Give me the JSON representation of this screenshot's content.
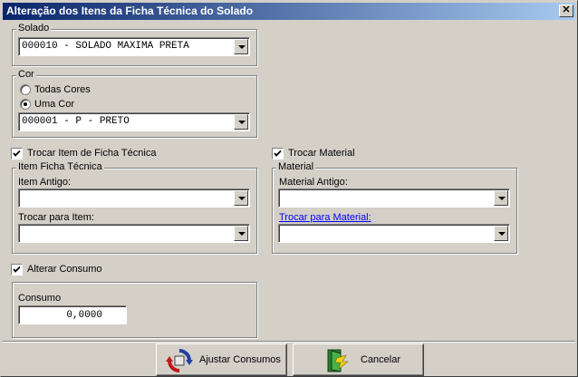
{
  "window": {
    "title": "Alteração dos Itens da Ficha Técnica do Solado",
    "close_label": "✕"
  },
  "solado": {
    "legend": "Solado",
    "value": "000010 - SOLADO MAXIMA PRETA"
  },
  "cor": {
    "legend": "Cor",
    "option_all": "Todas Cores",
    "option_one": "Uma Cor",
    "selected": "Uma Cor",
    "value": "000001 - P - PRETO"
  },
  "trocar_item": {
    "checkbox_label": "Trocar Item de Ficha Técnica",
    "checked": true,
    "legend": "Item Ficha Técnica",
    "old_label": "Item Antigo:",
    "old_value": "",
    "new_label": "Trocar para Item:",
    "new_value": ""
  },
  "trocar_material": {
    "checkbox_label": "Trocar Material",
    "checked": true,
    "legend": "Material",
    "old_label": "Material Antigo:",
    "old_value": "",
    "new_label": "Trocar para Material:",
    "new_value": ""
  },
  "consumo": {
    "checkbox_label": "Alterar Consumo",
    "checked": true,
    "label": "Consumo",
    "value": "0,0000"
  },
  "buttons": {
    "ajustar": "Ajustar Consumos",
    "cancelar": "Cancelar",
    "ajustar_icon": "refresh-arrows-icon",
    "cancelar_icon": "exit-door-icon"
  },
  "colors": {
    "title_start": "#0a246a",
    "title_end": "#a6caf0",
    "face": "#d4d0c8",
    "link": "#0000ff"
  }
}
